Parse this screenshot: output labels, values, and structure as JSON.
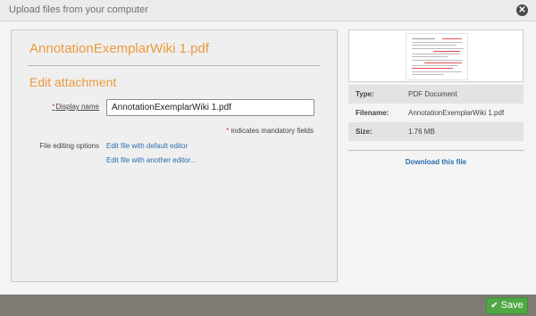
{
  "window": {
    "title": "Upload files from your computer",
    "close_symbol": "✕"
  },
  "file": {
    "name": "AnnotationExemplarWiki 1.pdf"
  },
  "form": {
    "section_title": "Edit attachment",
    "display_name_required_mark": "*",
    "display_name_label": "Display name",
    "display_name_value": "AnnotationExemplarWiki 1.pdf",
    "mandatory_star": "*",
    "mandatory_note": " indicates mandatory fields",
    "edit_options_label": "File editing options",
    "edit_default_link": "Edit file with default editor",
    "edit_other_link": "Edit file with another editor..."
  },
  "details": {
    "rows": [
      {
        "label": "Type:",
        "value": "PDF Document"
      },
      {
        "label": "Filename:",
        "value": "AnnotationExemplarWiki 1.pdf"
      },
      {
        "label": "Size:",
        "value": "1.76 MB"
      }
    ],
    "download_link": "Download this file"
  },
  "footer": {
    "save_label": "Save",
    "save_icon": "✔"
  },
  "colors": {
    "accent_orange": "#eb9a3d",
    "link_blue": "#2b6fad",
    "save_green": "#4fa844",
    "required_red": "#d73a3a"
  }
}
